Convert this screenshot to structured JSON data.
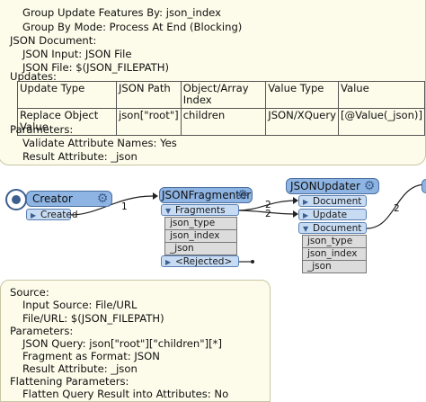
{
  "top_tooltip": {
    "group_update_features_by": "Group Update Features By: json_index",
    "group_by_mode": "Group By Mode: Process At End (Blocking)",
    "json_document_heading": "JSON Document:",
    "json_input": "JSON Input: JSON File",
    "json_file": "JSON File: $(JSON_FILEPATH)",
    "updates_heading": "Updates:",
    "updates_table": {
      "headers": [
        "Update Type",
        "JSON Path",
        "Object/Array Index",
        "Value Type",
        "Value"
      ],
      "row": [
        "Replace Object Value",
        "json[\"root\"]",
        "children",
        "JSON/XQuery",
        "[@Value(_json)]"
      ]
    },
    "parameters_heading": "Parameters:",
    "validate_attribute_names": "Validate Attribute Names: Yes",
    "result_attribute": "Result Attribute: _json"
  },
  "canvas": {
    "creator": {
      "title": "Creator",
      "output_port": "Created"
    },
    "json_fragmenter": {
      "title": "JSONFragmenter",
      "output_port": "Fragments",
      "attributes": [
        "json_type",
        "json_index",
        "_json"
      ],
      "rejected_port": "<Rejected>"
    },
    "json_updater": {
      "title": "JSONUpdater",
      "input_ports": [
        "Document",
        "Update"
      ],
      "output_port": "Document",
      "attributes": [
        "json_type",
        "json_index",
        "_json"
      ]
    },
    "connection_counts": {
      "creator_to_fragmenter": "1",
      "fragments_to_document": "2",
      "fragments_to_update": "2",
      "updater_out": "2"
    }
  },
  "bottom_tooltip": {
    "source_heading": "Source:",
    "input_source": "Input Source: File/URL",
    "file_url": "File/URL: $(JSON_FILEPATH)",
    "parameters_heading": "Parameters:",
    "json_query": "JSON Query: json[\"root\"][\"children\"][*]",
    "fragment_format": "Fragment as Format: JSON",
    "result_attribute": "Result Attribute: _json",
    "flattening_heading": "Flattening Parameters:",
    "flatten_query": "Flatten Query Result into Attributes: No"
  },
  "colors": {
    "transformer_header": "#8db4e2",
    "port": "#c7dbf3",
    "attribute": "#dcdcdc",
    "tooltip": "#fdfbe9"
  }
}
